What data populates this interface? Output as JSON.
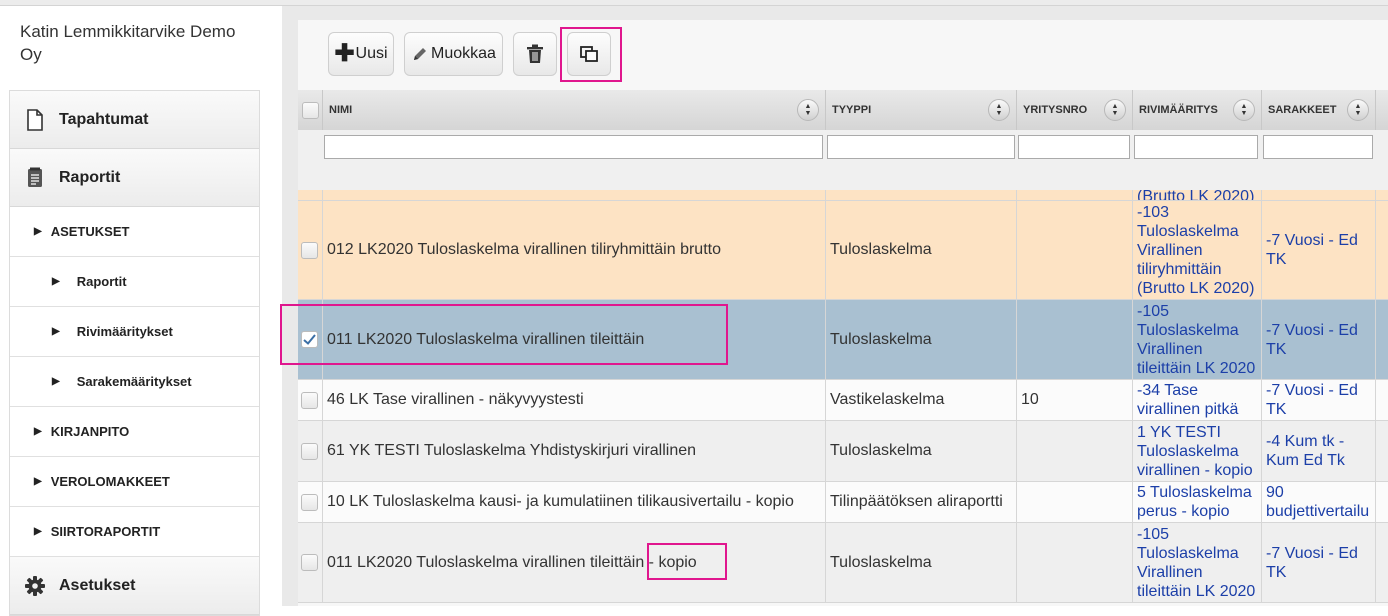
{
  "sidebar": {
    "company": "Katin Lemmikkitarvike Demo Oy",
    "items": [
      {
        "label": "Tapahtumat",
        "type": "main",
        "icon": "document-icon"
      },
      {
        "label": "Raportit",
        "type": "main",
        "icon": "report-icon"
      },
      {
        "label": "ASETUKSET",
        "type": "lvl1"
      },
      {
        "label": "Raportit",
        "type": "lvl2"
      },
      {
        "label": "Rivimääritykset",
        "type": "lvl2"
      },
      {
        "label": "Sarakemääritykset",
        "type": "lvl2"
      },
      {
        "label": "KIRJANPITO",
        "type": "lvl1"
      },
      {
        "label": "VEROLOMAKKEET",
        "type": "lvl1"
      },
      {
        "label": "SIIRTORAPORTIT",
        "type": "lvl1"
      },
      {
        "label": "Asetukset",
        "type": "main",
        "icon": "gear-icon"
      }
    ]
  },
  "toolbar": {
    "new_label": "Uusi",
    "edit_label": "Muokkaa"
  },
  "grid": {
    "columns": [
      "NIMI",
      "TYYPPI",
      "YRITYSNRO",
      "RIVIMÄÄRITYS",
      "SARAKKEET"
    ],
    "partial_top_row": {
      "rivi": "(Brutto LK 2020)"
    },
    "rows": [
      {
        "nimi": "012 LK2020 Tuloslaskelma virallinen tiliryhmittäin brutto",
        "tyyppi": "Tuloslaskelma",
        "yritysnro": "",
        "rivi": "-103 Tuloslaskelma Virallinen tiliryhmittäin (Brutto LK 2020)",
        "sarakkeet": "-7 Vuosi - Ed TK",
        "state": "highlight",
        "checked": false
      },
      {
        "nimi": "011 LK2020 Tuloslaskelma virallinen tileittäin",
        "tyyppi": "Tuloslaskelma",
        "yritysnro": "",
        "rivi": "-105 Tuloslaskelma Virallinen tileittäin LK 2020",
        "sarakkeet": "-7 Vuosi - Ed TK",
        "state": "selected",
        "checked": true
      },
      {
        "nimi": "46 LK Tase virallinen - näkyvyystesti",
        "tyyppi": "Vastikelaskelma",
        "yritysnro": "10",
        "rivi": "-34 Tase virallinen pitkä",
        "sarakkeet": "-7 Vuosi - Ed TK",
        "state": "normal",
        "checked": false
      },
      {
        "nimi": "61 YK TESTI Tuloslaskelma Yhdistyskirjuri virallinen",
        "tyyppi": "Tuloslaskelma",
        "yritysnro": "",
        "rivi": "1 YK TESTI Tuloslaskelma virallinen - kopio",
        "sarakkeet": "-4 Kum tk - Kum Ed Tk",
        "state": "alt",
        "checked": false
      },
      {
        "nimi": "10 LK Tuloslaskelma kausi- ja kumulatiinen tilikausivertailu - kopio",
        "tyyppi": "Tilinpäätöksen aliraportti",
        "yritysnro": "",
        "rivi": "5 Tuloslaskelma perus - kopio",
        "sarakkeet": "90 budjettivertailu",
        "state": "normal",
        "checked": false
      },
      {
        "nimi": "011 LK2020 Tuloslaskelma virallinen tileittäin - kopio",
        "tyyppi": "Tuloslaskelma",
        "yritysnro": "",
        "rivi": "-105 Tuloslaskelma Virallinen tileittäin LK 2020",
        "sarakkeet": "-7 Vuosi - Ed TK",
        "state": "alt",
        "checked": false
      }
    ]
  },
  "colors": {
    "highlight_row": "#fde3c4",
    "selected_row": "#a9c0d1",
    "annotation": "#e0168e",
    "link": "#1c3fa8"
  }
}
